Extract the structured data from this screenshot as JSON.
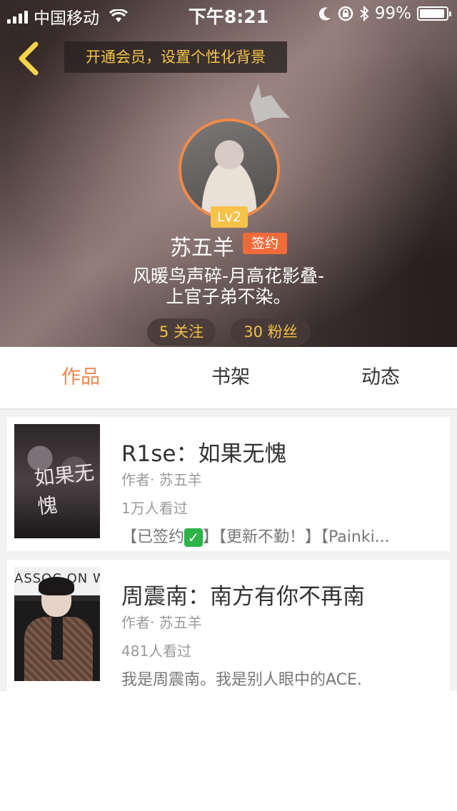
{
  "status_bar": {
    "carrier": "中国移动",
    "time": "下午8:21",
    "battery": "99%"
  },
  "header": {
    "promo": "开通会员，设置个性化背景",
    "level": "Lv2",
    "username": "苏五羊",
    "badge": "签约",
    "bio_line1": "风暖鸟声碎-月高花影叠-",
    "bio_line2": "上官子弟不染。",
    "following": "5 关注",
    "fans": "30 粉丝"
  },
  "tabs": [
    {
      "label": "作品",
      "active": true
    },
    {
      "label": "书架",
      "active": false
    },
    {
      "label": "动态",
      "active": false
    }
  ],
  "works": [
    {
      "title": "R1se：如果无愧",
      "author": "作者· 苏五羊",
      "views": "1万人看过",
      "tags_prefix": "【已签约",
      "tags_suffix": "】【更新不勤！】【Painki...",
      "cover_text": "如果无愧"
    },
    {
      "title": "周震南：南方有你不再南",
      "author": "作者· 苏五羊",
      "views": "481人看过",
      "description": "我是周震南。我是别人眼中的ACE.",
      "cover_text": "ASSOC ON W"
    }
  ],
  "colors": {
    "accent": "#f0874d",
    "gold": "#f5c142",
    "badge": "#f06a3a"
  }
}
